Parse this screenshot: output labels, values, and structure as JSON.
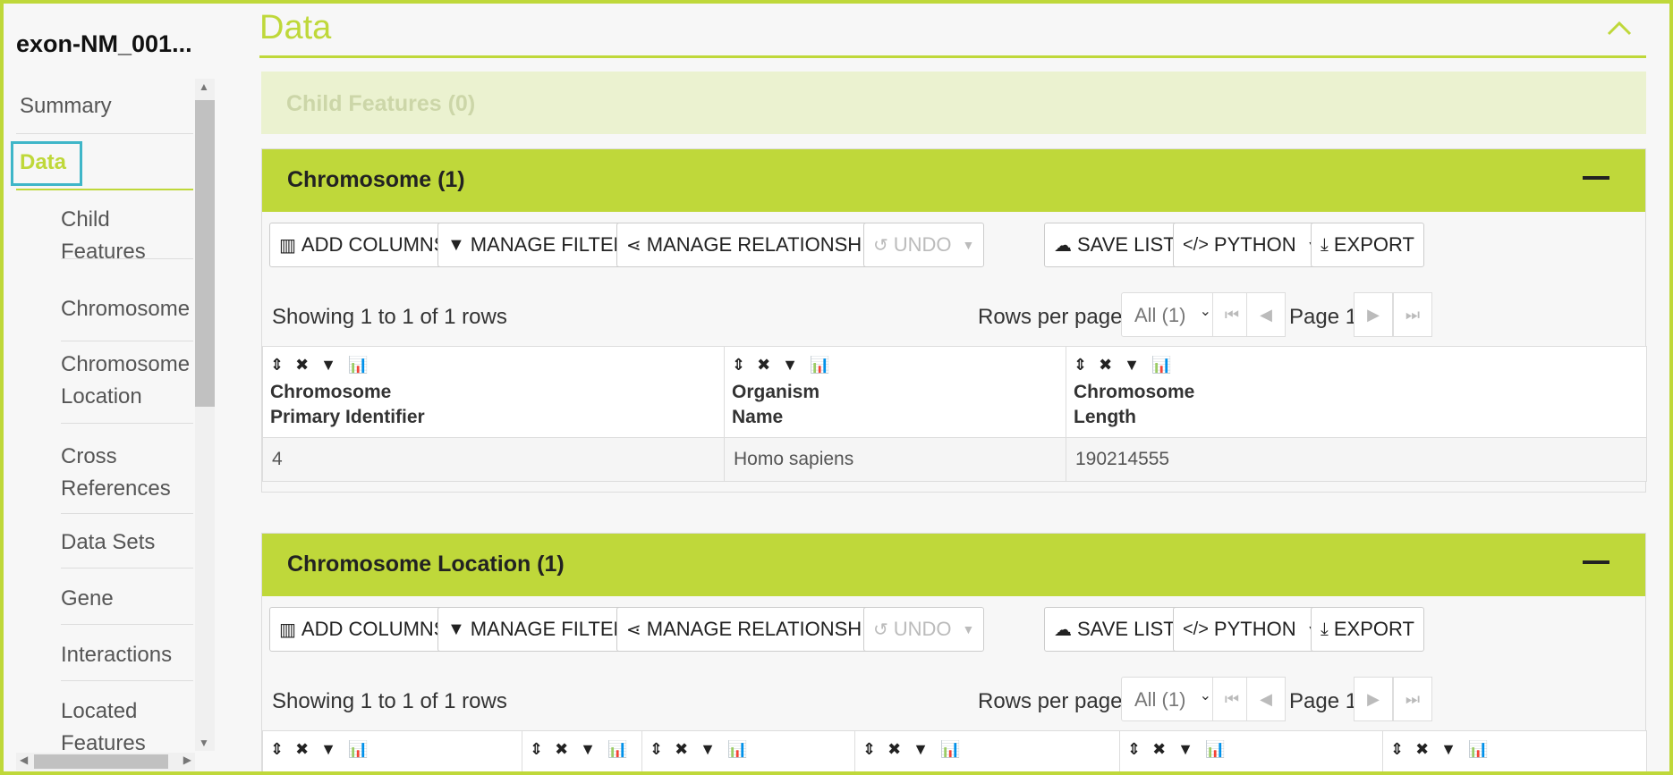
{
  "sidebar": {
    "title": "exon-NM_001...",
    "items": [
      {
        "label": "Summary"
      },
      {
        "label": "Data",
        "active": true
      }
    ],
    "subitems": [
      {
        "line1": "Child",
        "line2": "Features"
      },
      {
        "line1": "Chromosome",
        "line2": ""
      },
      {
        "line1": "Chromosome",
        "line2": "Location"
      },
      {
        "line1": "Cross",
        "line2": "References"
      },
      {
        "line1": "Data Sets",
        "line2": ""
      },
      {
        "line1": "Gene",
        "line2": ""
      },
      {
        "line1": "Interactions",
        "line2": ""
      },
      {
        "line1": "Located",
        "line2": "Features"
      }
    ]
  },
  "main": {
    "title": "Data",
    "child_features": "Child Features (0)",
    "toolbar": {
      "add_columns": "ADD COLUMNS",
      "manage_filters": "MANAGE FILTERS",
      "manage_relationships": "MANAGE RELATIONSHIPS",
      "undo": "UNDO",
      "save_list": "SAVE LIST",
      "python": "PYTHON",
      "export": "EXPORT"
    },
    "pager": {
      "showing": "Showing 1 to 1 of 1 rows",
      "rows_per_page": "Rows per page:",
      "rows_value": "All (1)",
      "page": "Page 1"
    },
    "panels": [
      {
        "title": "Chromosome (1)",
        "columns": [
          {
            "line1": "Chromosome",
            "line2": "Primary Identifier"
          },
          {
            "line1": "Organism",
            "line2": "Name"
          },
          {
            "line1": "Chromosome",
            "line2": "Length"
          }
        ],
        "rows": [
          [
            "4",
            "Homo sapiens",
            "190214555"
          ]
        ]
      },
      {
        "title": "Chromosome Location (1)",
        "columns": [
          {},
          {},
          {},
          {},
          {},
          {}
        ]
      }
    ]
  },
  "colors": {
    "accent": "#bfd83a",
    "active_outline": "#3fb6c8",
    "child_bar": "#ebf2d0"
  },
  "icons": [
    "sort-icon",
    "remove-icon",
    "filter-icon",
    "chart-icon",
    "columns-icon",
    "share-icon",
    "undo-icon",
    "cloud-upload-icon",
    "code-icon",
    "download-icon",
    "chevron-up-icon",
    "minus-icon"
  ]
}
